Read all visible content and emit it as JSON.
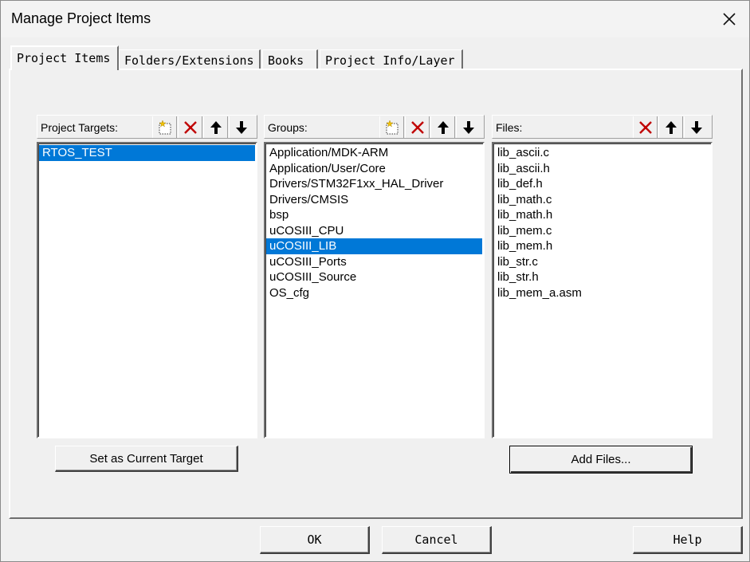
{
  "window": {
    "title": "Manage Project Items"
  },
  "tabs": [
    {
      "label": "Project Items",
      "active": true
    },
    {
      "label": "Folders/Extensions",
      "active": false
    },
    {
      "label": "Books",
      "active": false
    },
    {
      "label": "Project Info/Layer",
      "active": false
    }
  ],
  "targets": {
    "label": "Project Targets:",
    "items": [
      {
        "text": "RTOS_TEST",
        "selected": true
      }
    ],
    "button": "Set as Current Target"
  },
  "groups": {
    "label": "Groups:",
    "items": [
      {
        "text": "Application/MDK-ARM",
        "selected": false
      },
      {
        "text": "Application/User/Core",
        "selected": false
      },
      {
        "text": "Drivers/STM32F1xx_HAL_Driver",
        "selected": false
      },
      {
        "text": "Drivers/CMSIS",
        "selected": false
      },
      {
        "text": "bsp",
        "selected": false
      },
      {
        "text": "uCOSIII_CPU",
        "selected": false
      },
      {
        "text": "uCOSIII_LIB",
        "selected": true
      },
      {
        "text": "uCOSIII_Ports",
        "selected": false
      },
      {
        "text": "uCOSIII_Source",
        "selected": false
      },
      {
        "text": "OS_cfg",
        "selected": false
      }
    ]
  },
  "files": {
    "label": "Files:",
    "items": [
      {
        "text": "lib_ascii.c"
      },
      {
        "text": "lib_ascii.h"
      },
      {
        "text": "lib_def.h"
      },
      {
        "text": "lib_math.c"
      },
      {
        "text": "lib_math.h"
      },
      {
        "text": "lib_mem.c"
      },
      {
        "text": "lib_mem.h"
      },
      {
        "text": "lib_str.c"
      },
      {
        "text": "lib_str.h"
      },
      {
        "text": "lib_mem_a.asm"
      }
    ],
    "button": "Add Files..."
  },
  "footer": {
    "ok": "OK",
    "cancel": "Cancel",
    "help": "Help"
  },
  "colors": {
    "selection": "#0078d7",
    "delete_icon": "#c00000",
    "new_icon": "#f2c200"
  }
}
